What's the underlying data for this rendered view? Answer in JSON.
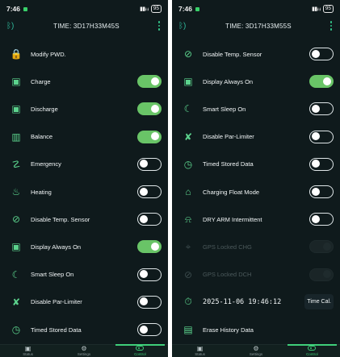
{
  "left": {
    "status": {
      "time": "7:46",
      "battery": "95"
    },
    "appbar": {
      "title": "TIME: 3D17H33M45S"
    },
    "items": [
      {
        "label": "Modify PWD.",
        "icon": "lock-icon",
        "glyph": "🔒",
        "control": "none"
      },
      {
        "label": "Charge",
        "icon": "charge-battery-icon",
        "glyph": "▣",
        "control": "on"
      },
      {
        "label": "Discharge",
        "icon": "discharge-battery-icon",
        "glyph": "▣",
        "control": "on"
      },
      {
        "label": "Balance",
        "icon": "balance-icon",
        "glyph": "▥",
        "control": "on"
      },
      {
        "label": "Emergency",
        "icon": "emergency-light-icon",
        "glyph": "☡",
        "control": "off"
      },
      {
        "label": "Heating",
        "icon": "heating-icon",
        "glyph": "♨",
        "control": "off"
      },
      {
        "label": "Disable Temp. Sensor",
        "icon": "temp-sensor-off-icon",
        "glyph": "⊘",
        "control": "off"
      },
      {
        "label": "Display Always On",
        "icon": "display-icon",
        "glyph": "▣",
        "control": "on"
      },
      {
        "label": "Smart Sleep On",
        "icon": "moon-icon",
        "glyph": "☾",
        "control": "off"
      },
      {
        "label": "Disable Par-Limiter",
        "icon": "par-limiter-off-icon",
        "glyph": "✘",
        "control": "off"
      },
      {
        "label": "Timed Stored Data",
        "icon": "timed-data-icon",
        "glyph": "◷",
        "control": "off"
      }
    ],
    "nav": [
      {
        "label": "Status",
        "icon": "status-icon",
        "glyph": "▣"
      },
      {
        "label": "Settings",
        "icon": "settings-gear-icon",
        "glyph": "⚙"
      },
      {
        "label": "Control",
        "icon": "control-toggle-icon",
        "glyph": ""
      }
    ]
  },
  "right": {
    "status": {
      "time": "7:46",
      "battery": "95"
    },
    "appbar": {
      "title": "TIME: 3D17H33M55S"
    },
    "items": [
      {
        "label": "Disable Temp. Sensor",
        "icon": "temp-sensor-off-icon",
        "glyph": "⊘",
        "control": "off"
      },
      {
        "label": "Display Always On",
        "icon": "display-icon",
        "glyph": "▣",
        "control": "on"
      },
      {
        "label": "Smart Sleep On",
        "icon": "moon-icon",
        "glyph": "☾",
        "control": "off"
      },
      {
        "label": "Disable Par-Limiter",
        "icon": "par-limiter-off-icon",
        "glyph": "✘",
        "control": "off"
      },
      {
        "label": "Timed Stored Data",
        "icon": "timed-data-icon",
        "glyph": "◷",
        "control": "off"
      },
      {
        "label": "Charging Float Mode",
        "icon": "float-mode-icon",
        "glyph": "⌂",
        "control": "off"
      },
      {
        "label": "DRY ARM Intermittent",
        "icon": "alarm-bell-icon",
        "glyph": "⍾",
        "control": "off"
      },
      {
        "label": "GPS Locked CHG",
        "icon": "gps-icon",
        "glyph": "⌖",
        "control": "disabled"
      },
      {
        "label": "GPS Locked DCH",
        "icon": "gps-off-icon",
        "glyph": "⊘",
        "control": "disabled"
      },
      {
        "label": "2025-11-06 19:46:12",
        "icon": "clock-icon",
        "glyph": "⏱",
        "control": "button",
        "button_label": "Time Cal."
      },
      {
        "label": "Erase History Data",
        "icon": "erase-data-icon",
        "glyph": "▤",
        "control": "none"
      }
    ],
    "nav": [
      {
        "label": "Status",
        "icon": "status-icon",
        "glyph": "▣"
      },
      {
        "label": "Settings",
        "icon": "settings-gear-icon",
        "glyph": "⚙"
      },
      {
        "label": "Control",
        "icon": "control-toggle-icon",
        "glyph": ""
      }
    ]
  },
  "colors": {
    "background": "#0f1a1c",
    "accent": "#69c467",
    "icon": "#5cd38d"
  }
}
